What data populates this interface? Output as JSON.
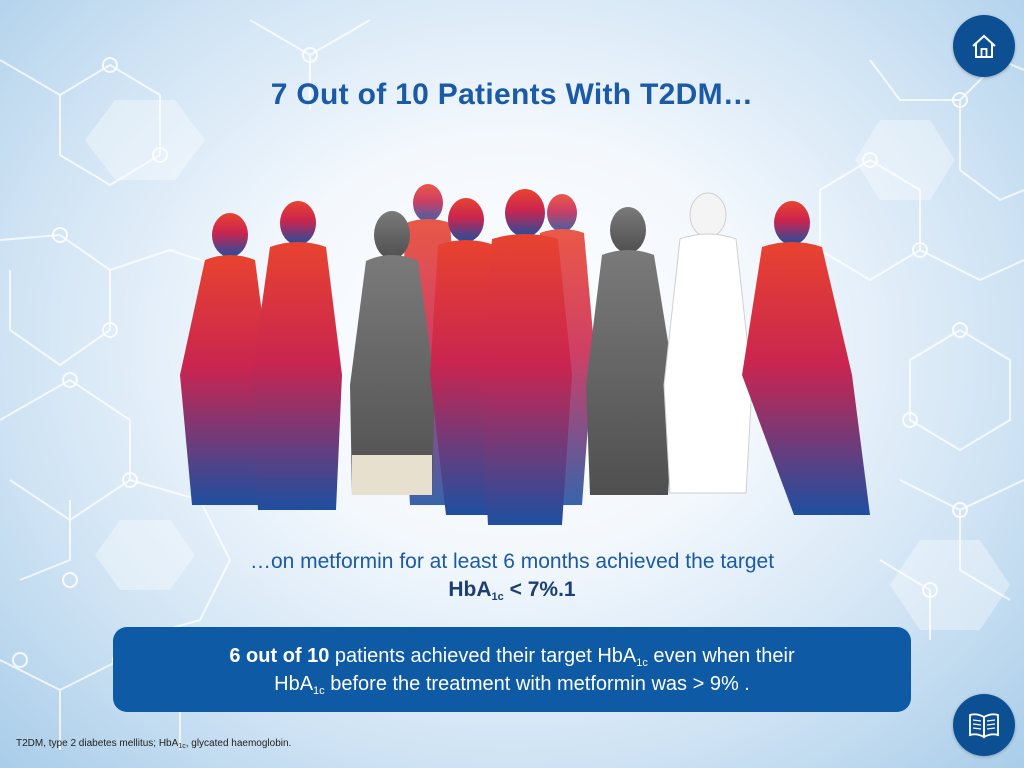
{
  "title": "7 Out of 10 Patients With T2DM…",
  "subtitle": {
    "line1": "…on metformin for at least 6 months achieved the target",
    "line2_prefix": "HbA",
    "line2_sub": "1c",
    "line2_suffix": " < 7%.1"
  },
  "callout": {
    "bold": "6 out of 10",
    "text1": " patients achieved their target HbA",
    "sub1": "1c",
    "text2": " even when their",
    "text3": "HbA",
    "sub2": "1c",
    "text4": " before the treatment with metformin was > 9% ."
  },
  "footnote": {
    "part1": "T2DM, type 2 diabetes mellitus; HbA",
    "sub": "1c",
    "part2": ", glycated haemoglobin."
  },
  "icons": {
    "home": "home-icon",
    "references": "book-icon"
  },
  "colors": {
    "title": "#1a5aa6",
    "callout_bg": "#0e5aa5",
    "button_bg": "#0d4f93",
    "highlight_gradient_top": "#e8432f",
    "highlight_gradient_bottom": "#1e4fa0",
    "muted_figures": "#777777"
  },
  "illustration": {
    "total_people": 10,
    "highlighted_people": 7
  }
}
